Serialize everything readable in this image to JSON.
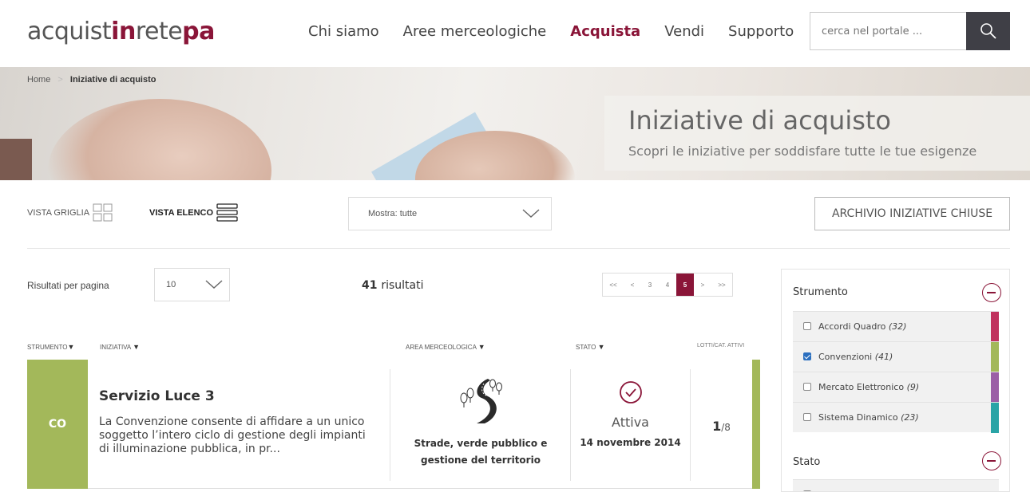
{
  "logo": {
    "part1": "acquist",
    "part2": "in",
    "part3": "rete",
    "part4": "pa"
  },
  "nav": [
    {
      "label": "Chi siamo",
      "active": false
    },
    {
      "label": "Aree merceologiche",
      "active": false
    },
    {
      "label": "Acquista",
      "active": true
    },
    {
      "label": "Vendi",
      "active": false
    },
    {
      "label": "Supporto",
      "active": false
    }
  ],
  "search": {
    "placeholder": "cerca nel portale ...",
    "icon": "search-icon"
  },
  "breadcrumb": {
    "home": "Home",
    "separator": ">",
    "current": "Iniziative di acquisto"
  },
  "hero": {
    "title": "Iniziative di acquisto",
    "subtitle": "Scopri le iniziative per soddisfare tutte le tue esigenze"
  },
  "toolbar": {
    "grid_label": "VISTA GRIGLIA",
    "list_label": "VISTA ELENCO",
    "show_select": "Mostra: tutte",
    "archive_button": "ARCHIVIO INIZIATIVE CHIUSE"
  },
  "results": {
    "per_page_label": "Risultati per pagina",
    "per_page_value": "10",
    "count_number": "41",
    "count_label": "risultati"
  },
  "pagination": {
    "first": "<<",
    "prev": "<",
    "pages": [
      "3",
      "4",
      "5"
    ],
    "current": "5",
    "next": ">",
    "last": ">>"
  },
  "table": {
    "headers": {
      "strumento": "STRUMENTO",
      "iniziativa": "INIZIATIVA",
      "area": "AREA MERCEOLOGICA",
      "stato": "STATO",
      "lotti": "LOTTI/CAT. ATTIVI"
    },
    "rows": [
      {
        "code": "CO",
        "title": "Servizio Luce 3",
        "description": "La Convenzione consente di affidare a un unico soggetto l’intero ciclo di gestione degli impianti di illuminazione pubblica, in pr...",
        "area_line1": "Strade, verde pubblico e",
        "area_line2": "gestione del territorio",
        "status": "Attiva",
        "date": "14 novembre 2014",
        "lotti_active": "1",
        "lotti_total": "/8",
        "color": "#a3b85a"
      }
    ]
  },
  "sidebar": {
    "strumento_title": "Strumento",
    "strumento_items": [
      {
        "label": "Accordi Quadro",
        "count": "(32)",
        "checked": false,
        "color": "#c0325e"
      },
      {
        "label": "Convenzioni",
        "count": "(41)",
        "checked": true,
        "color": "#a3b85a"
      },
      {
        "label": "Mercato Elettronico",
        "count": "(9)",
        "checked": false,
        "color": "#9b5fa6"
      },
      {
        "label": "Sistema Dinamico",
        "count": "(23)",
        "checked": false,
        "color": "#2aa4a6"
      }
    ],
    "stato_title": "Stato"
  },
  "colors": {
    "brand": "#8a1538",
    "dark_button": "#3f3f46",
    "checkbox_blue": "#2b6fbf"
  }
}
